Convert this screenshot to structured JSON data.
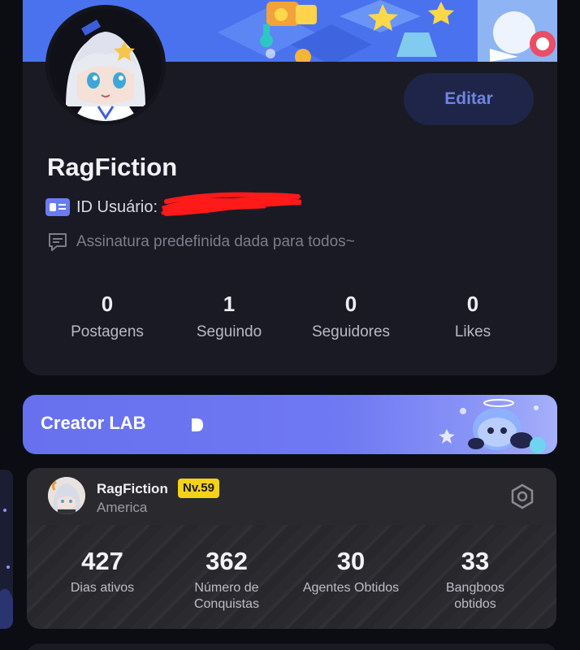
{
  "profile": {
    "username": "RagFiction",
    "edit_label": "Editar",
    "user_id_label": "ID Usuário:",
    "signature": "Assinatura predefinida dada para todos~",
    "stats": [
      {
        "value": "0",
        "label": "Postagens"
      },
      {
        "value": "1",
        "label": "Seguindo"
      },
      {
        "value": "0",
        "label": "Seguidores"
      },
      {
        "value": "0",
        "label": "Likes"
      }
    ]
  },
  "creator_lab": {
    "label": "Creator LAB",
    "accent": "#6770ee"
  },
  "game_card": {
    "name": "RagFiction",
    "level": "Nv.59",
    "region": "America",
    "level_color": "#f5d21a",
    "stats": [
      {
        "value": "427",
        "label": "Dias ativos"
      },
      {
        "value": "362",
        "label": "Número de Conquistas"
      },
      {
        "value": "30",
        "label": "Agentes Obtidos"
      },
      {
        "value": "33",
        "label": "Bangboos obtidos"
      }
    ]
  },
  "icons": {
    "id_card": "id-card-icon",
    "signature": "chat-bubble-icon",
    "arrow": "play-arrow-icon",
    "settings": "settings-icon"
  }
}
